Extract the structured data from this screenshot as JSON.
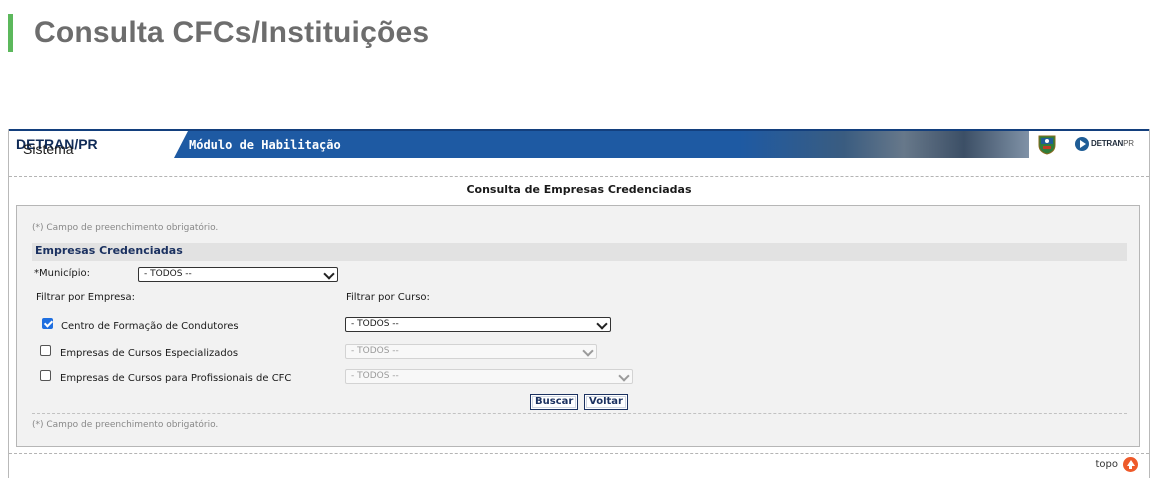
{
  "page": {
    "title": "Consulta CFCs/Instituições"
  },
  "banner": {
    "system_label": "Sistema ",
    "system_name": "DETRAN/PR",
    "module": "Módulo de Habilitação",
    "logo_text": "DETRAN",
    "logo_suffix": "PR"
  },
  "section": {
    "title": "Consulta de Empresas Credenciadas"
  },
  "form": {
    "required_hint": "(*) Campo de preenchimento obrigatório.",
    "group_title": "Empresas Credenciadas",
    "municipio_label": "*Município:",
    "municipio_value": "- TODOS --",
    "filter_empresa_label": "Filtrar por Empresa:",
    "filter_curso_label": "Filtrar por Curso:",
    "rows": [
      {
        "label": "Centro de Formação de Condutores",
        "checked": true,
        "curso_value": "- TODOS --",
        "enabled": true
      },
      {
        "label": "Empresas de Cursos Especializados",
        "checked": false,
        "curso_value": "- TODOS --",
        "enabled": false
      },
      {
        "label": "Empresas de Cursos para Profissionais de CFC",
        "checked": false,
        "curso_value": "- TODOS --",
        "enabled": false
      }
    ],
    "buttons": {
      "search": "Buscar",
      "back": "Voltar"
    }
  },
  "footer": {
    "top_link": "topo"
  },
  "colors": {
    "accent_bar": "#5cb85c",
    "banner_blue": "#1e5aa3",
    "title_text": "#1b3160",
    "checkbox_checked": "#1f6fe0",
    "topo_icon": "#ee5a2a"
  }
}
